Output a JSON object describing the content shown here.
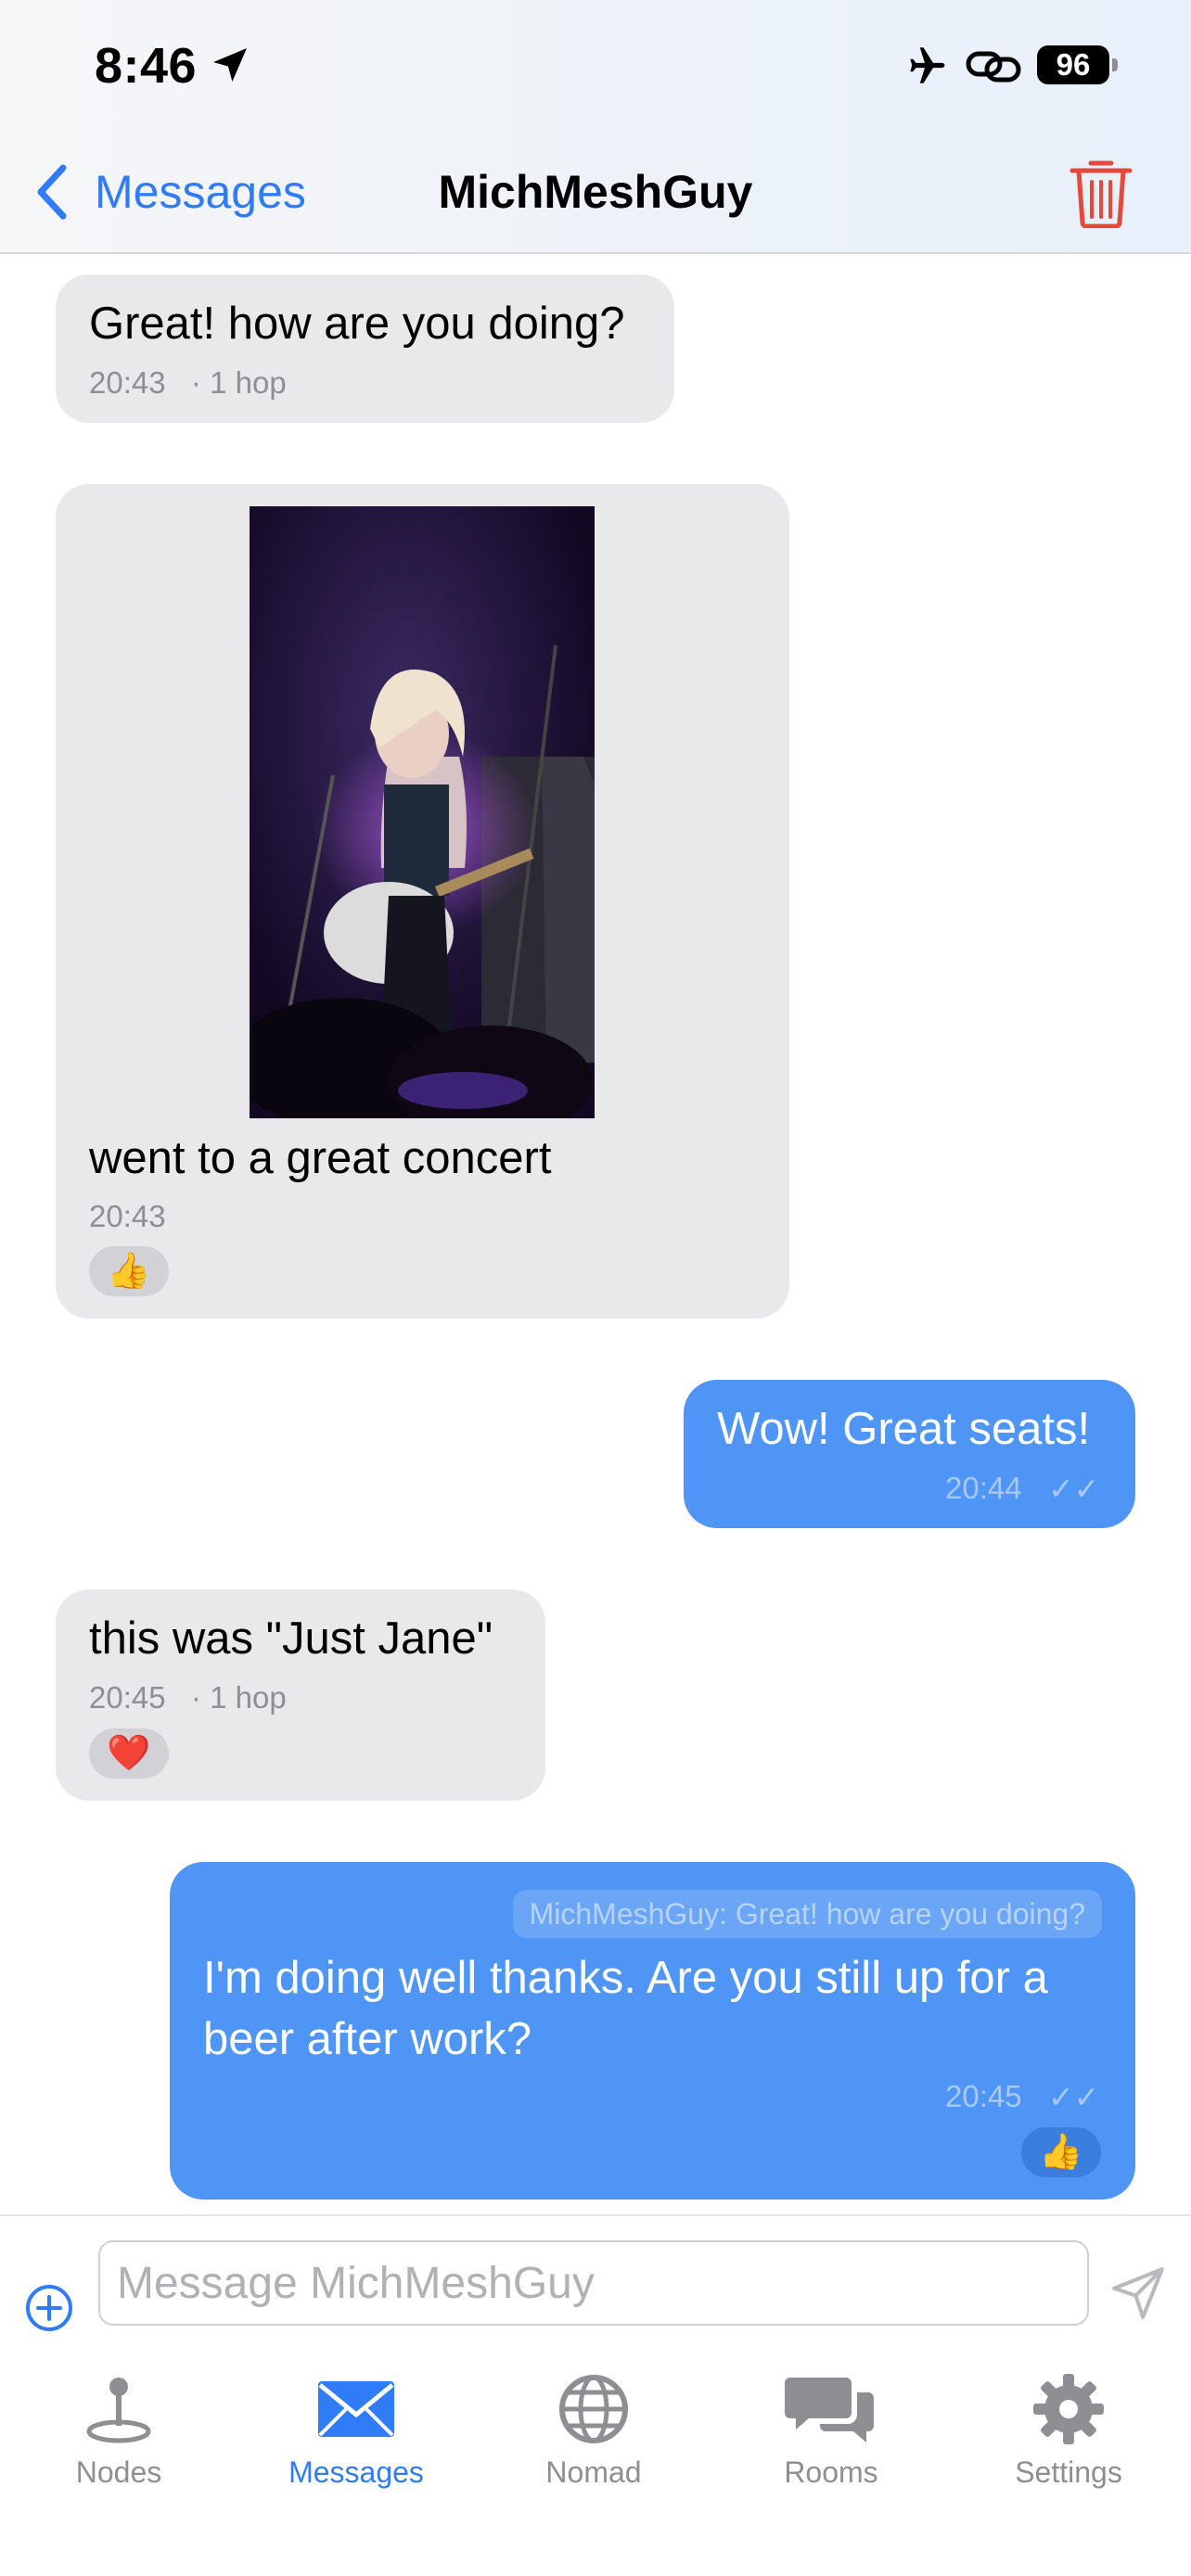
{
  "status_bar": {
    "time": "8:46",
    "battery": "96"
  },
  "nav": {
    "back_label": "Messages",
    "title": "MichMeshGuy"
  },
  "messages": [
    {
      "direction": "in",
      "text": "Great! how are you doing?",
      "time": "20:43",
      "hops": "· 1 hop"
    },
    {
      "direction": "in",
      "text": "went to a great concert",
      "time": "20:43",
      "reaction": "👍",
      "has_image": true
    },
    {
      "direction": "out",
      "text": "Wow! Great seats!",
      "time": "20:44",
      "status": "✓✓"
    },
    {
      "direction": "in",
      "text": "this was \"Just Jane\"",
      "time": "20:45",
      "hops": "· 1 hop",
      "reaction": "❤️"
    },
    {
      "direction": "out",
      "reply_to": "MichMeshGuy: Great! how are you doing?",
      "text_line1": "I'm doing well thanks. Are you still up for a",
      "text_line2": "beer after work?",
      "time": "20:45",
      "status": "✓✓",
      "reaction": "👍"
    }
  ],
  "composer": {
    "placeholder": "Message MichMeshGuy"
  },
  "tabs": [
    {
      "label": "Nodes",
      "icon": "pin-icon"
    },
    {
      "label": "Messages",
      "icon": "envelope-icon",
      "active": true
    },
    {
      "label": "Nomad",
      "icon": "globe-icon"
    },
    {
      "label": "Rooms",
      "icon": "chat-bubbles-icon"
    },
    {
      "label": "Settings",
      "icon": "gear-icon"
    }
  ],
  "colors": {
    "accent": "#2f7cf6",
    "outgoing_bubble": "#4e95f5",
    "incoming_bubble": "#e9e9eb",
    "delete": "#e5483d"
  }
}
